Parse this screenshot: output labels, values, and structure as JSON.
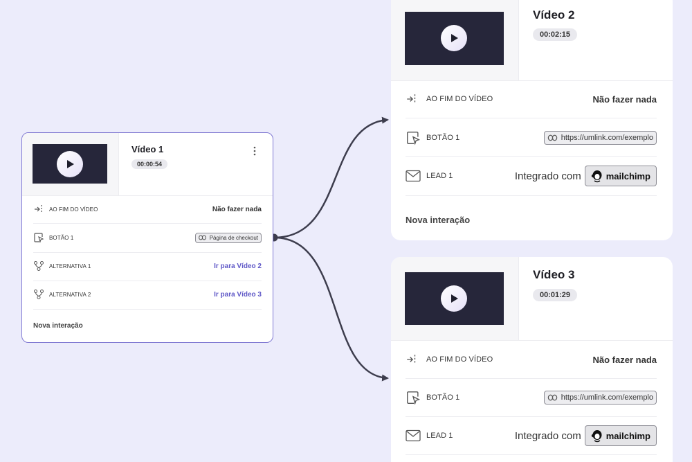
{
  "connector_color": "#3d3d4d",
  "accent_color": "#5f58c7",
  "video1": {
    "title": "Vídeo 1",
    "duration": "00:00:54",
    "menu_icon": "more-vertical-icon",
    "rows": [
      {
        "label": "AO FIM DO VÍDEO",
        "value": "Não fazer nada",
        "icon": "arrow-to-line-icon"
      },
      {
        "label": "BOTÃO 1",
        "value": "Página de checkout",
        "icon": "cursor-click-icon"
      },
      {
        "label": "ALTERNATIVA 1",
        "value": "Ir para Vídeo 2",
        "icon": "branch-icon"
      },
      {
        "label": "ALTERNATIVA 2",
        "value": "Ir para Vídeo 3",
        "icon": "branch-icon"
      }
    ],
    "new_interaction": "Nova interação"
  },
  "video2": {
    "title": "Vídeo 2",
    "duration": "00:02:15",
    "rows": [
      {
        "label": "AO FIM DO VÍDEO",
        "value": "Não fazer nada",
        "icon": "arrow-to-line-icon"
      },
      {
        "label": "BOTÃO 1",
        "value": "https://umlink.com/exemplo",
        "icon": "cursor-click-icon"
      },
      {
        "label": "LEAD 1",
        "value_prefix": "Integrado com",
        "value": "mailchimp",
        "icon": "mail-icon"
      }
    ],
    "new_interaction": "Nova interação"
  },
  "video3": {
    "title": "Vídeo 3",
    "duration": "00:01:29",
    "rows": [
      {
        "label": "AO FIM DO VÍDEO",
        "value": "Não fazer nada",
        "icon": "arrow-to-line-icon"
      },
      {
        "label": "BOTÃO 1",
        "value": "https://umlink.com/exemplo",
        "icon": "cursor-click-icon"
      },
      {
        "label": "LEAD 1",
        "value_prefix": "Integrado com",
        "value": "mailchimp",
        "icon": "mail-icon"
      }
    ]
  }
}
